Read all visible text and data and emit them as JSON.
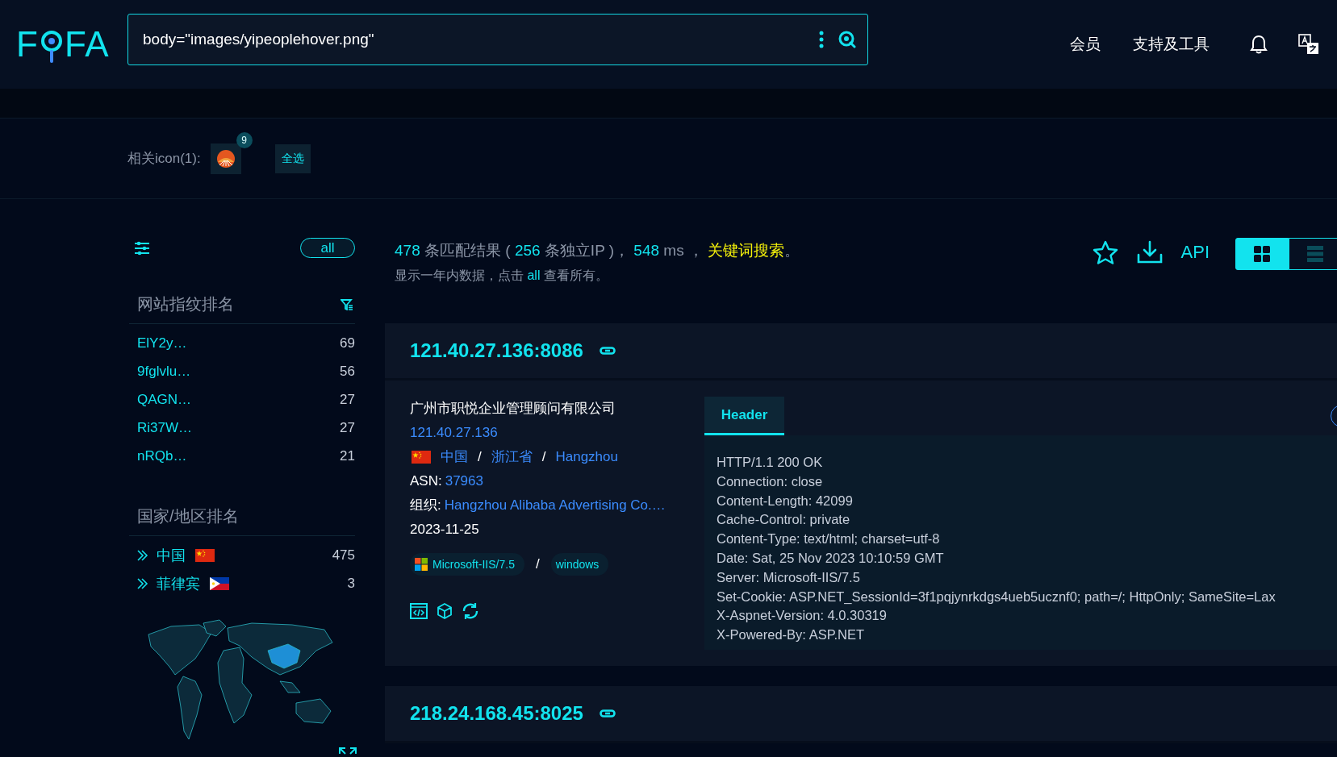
{
  "header": {
    "logo": [
      "F",
      "FA"
    ],
    "search": {
      "value": "body=\"images/yipeoplehover.png\""
    },
    "nav": [
      {
        "label": "会员"
      },
      {
        "label": "支持及工具"
      }
    ]
  },
  "related_icons": {
    "label": "相关icon(1):",
    "icons": [
      {
        "count": "9"
      }
    ],
    "select_all": "全选"
  },
  "sidebar": {
    "all_button": "all",
    "fingerprints": {
      "title": "网站指纹排名",
      "items": [
        {
          "name": "ElY2y…",
          "count": "69"
        },
        {
          "name": "9fglvlu…",
          "count": "56"
        },
        {
          "name": "QAGN…",
          "count": "27"
        },
        {
          "name": "Ri37W…",
          "count": "27"
        },
        {
          "name": "nRQb…",
          "count": "21"
        }
      ]
    },
    "countries": {
      "title": "国家/地区排名",
      "items": [
        {
          "name": "中国",
          "kind": "china",
          "count": "475"
        },
        {
          "name": "菲律宾",
          "kind": "philippines",
          "count": "3"
        }
      ]
    }
  },
  "summary": {
    "line_1": [
      {
        "kind": "number",
        "text": "478"
      },
      {
        "kind": "plain",
        "text": " 条匹配结果 ( "
      },
      {
        "kind": "number",
        "text": "256"
      },
      {
        "kind": "plain",
        "text": " 条独立IP )， "
      },
      {
        "kind": "number",
        "text": "548"
      },
      {
        "kind": "plain",
        "text": " ms ， "
      },
      {
        "kind": "highlight",
        "text": "关键词搜索"
      },
      {
        "kind": "plain",
        "text": "。"
      }
    ],
    "line_2": [
      {
        "kind": "plain",
        "text": "显示一年内数据，点击 "
      },
      {
        "kind": "link",
        "text": "all"
      },
      {
        "kind": "plain",
        "text": " 查看所有。"
      }
    ]
  },
  "toolbar": {
    "api": "API",
    "views": [
      {
        "kind": "grid",
        "selected": true
      },
      {
        "kind": "list",
        "selected": false
      }
    ]
  },
  "results": [
    {
      "address": "121.40.27.136:8086",
      "org": "广州市职悦企业管理顾问有限公司",
      "ip": "121.40.27.136",
      "location": [
        {
          "kind": "china"
        },
        {
          "kind": "link",
          "text": "中国"
        },
        {
          "kind": "separator",
          "text": "/"
        },
        {
          "kind": "link",
          "text": "浙江省"
        },
        {
          "kind": "separator",
          "text": "/"
        },
        {
          "kind": "link",
          "text": "Hangzhou"
        }
      ],
      "asn_label": "ASN:",
      "asn": "37963",
      "org_label": "组织:",
      "org_name": "Hangzhou Alibaba Advertising Co.…",
      "date": "2023-11-25",
      "tags": [
        {
          "kind": "product",
          "text": "Microsoft-IIS/7.5"
        },
        {
          "kind": "separator",
          "text": "/"
        },
        {
          "kind": "tag",
          "text": "windows"
        }
      ],
      "tabs": [
        {
          "label": "Header",
          "selected": true
        }
      ],
      "header_lines": [
        "HTTP/1.1 200 OK",
        "Connection: close",
        "Content-Length: 42099",
        "Cache-Control: private",
        "Content-Type: text/html; charset=utf-8",
        "Date: Sat, 25 Nov 2023 10:10:59 GMT",
        "Server: Microsoft-IIS/7.5",
        "Set-Cookie: ASP.NET_SessionId=3f1pqjynrkdgs4ueb5ucznf0; path=/; HttpOnly; SameSite=Lax",
        "X-Aspnet-Version: 4.0.30319",
        "X-Powered-By: ASP.NET"
      ]
    },
    {
      "address": "218.24.168.45:8025"
    }
  ]
}
